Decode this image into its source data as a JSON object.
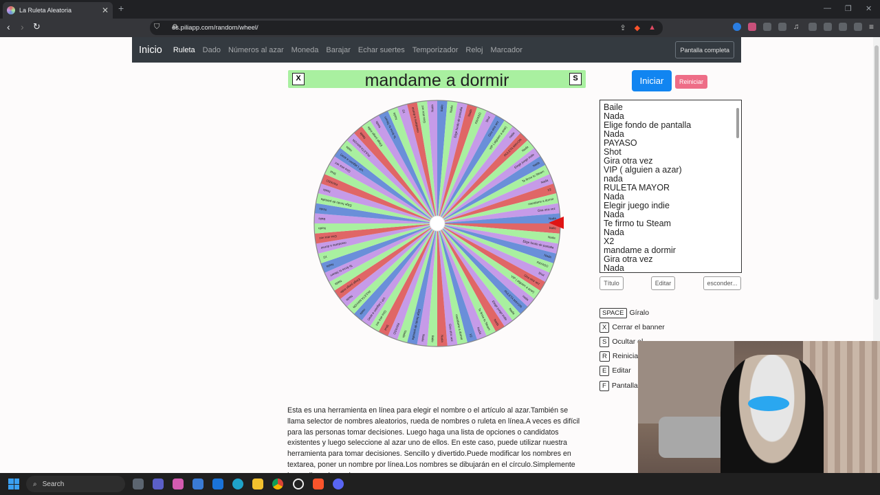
{
  "browser": {
    "tab_title": "La Ruleta Aleatoria",
    "url": "es.piliapp.com/random/wheel/"
  },
  "navbar": {
    "brand": "Inicio",
    "links": [
      "Ruleta",
      "Dado",
      "Números al azar",
      "Moneda",
      "Barajar",
      "Echar suertes",
      "Temporizador",
      "Reloj",
      "Marcador"
    ],
    "fullscreen": "Pantalla completa"
  },
  "banner": {
    "text": "mandame a dormir",
    "close_key": "X",
    "hide_key": "S"
  },
  "buttons": {
    "start": "Iniciar",
    "reset": "Reiniciar",
    "title": "Título",
    "edit": "Editar",
    "hide": "esconder..."
  },
  "names": [
    "Baile",
    "Nada",
    "Elige fondo de pantalla",
    "Nada",
    "PAYASO",
    "Shot",
    "Gira otra vez",
    "VIP ( alguien a azar)",
    "nada",
    "RULETA MAYOR",
    "Nada",
    "Elegir juego indie",
    "Nada",
    "Te firmo tu Steam",
    "Nada",
    "X2",
    "mandame a dormir",
    "Gira otra vez",
    "Nada"
  ],
  "shortcuts": [
    {
      "key": "SPACE",
      "label": "Gíralo"
    },
    {
      "key": "X",
      "label": "Cerrar el banner"
    },
    {
      "key": "S",
      "label": "Ocultar el..."
    },
    {
      "key": "R",
      "label": "Reiniciar"
    },
    {
      "key": "E",
      "label": "Editar"
    },
    {
      "key": "F",
      "label": "Pantalla"
    }
  ],
  "description": "Esta es una herramienta en línea para elegir el nombre o el artículo al azar.También se llama selector de nombres aleatorios, rueda de nombres o ruleta en línea.A veces es difícil para las personas tomar decisiones. Luego haga una lista de opciones o candidatos existentes y luego seleccione al azar uno de ellos. En este caso, puede utilizar nuestra herramienta para tomar decisiones. Sencillo y divertido.Puede modificar los nombres en textarea, poner un nombre por línea.Los nombres se dibujarán en el círculo.Simplemente haga clic en la rueda",
  "wheel": {
    "segment_colors": [
      "#e06666",
      "#a9f0a0",
      "#c69be8",
      "#6a8fd9",
      "#f4c7c3"
    ],
    "segment_count": 76
  },
  "taskbar": {
    "search": "Search"
  },
  "colors": {
    "navbar_bg": "#343a40",
    "start_btn": "#1185f1",
    "reset_btn": "#ee6d87",
    "banner_bg": "#a9f0a0",
    "pointer": "#e01414"
  }
}
